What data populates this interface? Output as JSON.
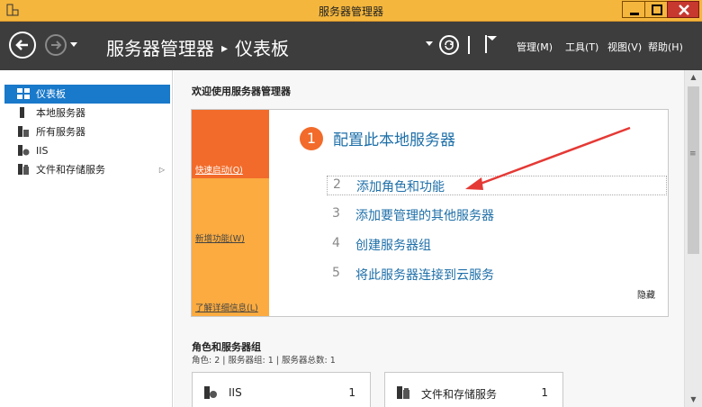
{
  "window": {
    "title": "服务器管理器"
  },
  "nav": {
    "breadcrumb_root": "服务器管理器",
    "breadcrumb_sep": "▸",
    "breadcrumb_current": "仪表板",
    "menus": [
      "管理(M)",
      "工具(T)",
      "视图(V)",
      "帮助(H)"
    ]
  },
  "sidebar": {
    "items": [
      {
        "label": "仪表板",
        "icon": "dashboard-icon",
        "active": true
      },
      {
        "label": "本地服务器",
        "icon": "server-icon"
      },
      {
        "label": "所有服务器",
        "icon": "servers-icon"
      },
      {
        "label": "IIS",
        "icon": "iis-icon"
      },
      {
        "label": "文件和存储服务",
        "icon": "file-storage-icon",
        "expand": "▷"
      }
    ]
  },
  "main": {
    "welcome": "欢迎使用服务器管理器",
    "tiles": [
      "快速启动(Q)",
      "新增功能(W)",
      "了解详细信息(L)"
    ],
    "step1": {
      "num": "1",
      "label": "配置此本地服务器"
    },
    "steps": [
      {
        "num": "2",
        "label": "添加角色和功能"
      },
      {
        "num": "3",
        "label": "添加要管理的其他服务器"
      },
      {
        "num": "4",
        "label": "创建服务器组"
      },
      {
        "num": "5",
        "label": "将此服务器连接到云服务"
      }
    ],
    "hide": "隐藏",
    "roles_title": "角色和服务器组",
    "roles_sub": "角色: 2 | 服务器组: 1 | 服务器总数: 1",
    "cards": [
      {
        "name": "IIS",
        "count": "1",
        "icon": "iis-icon"
      },
      {
        "name": "文件和存储服务",
        "count": "1",
        "icon": "file-storage-icon"
      }
    ]
  },
  "colors": {
    "accent": "#1979ca",
    "titlebar": "#f4b63d",
    "quickstart": "#f26b2a",
    "tile": "#fbab40",
    "annotation_arrow": "#e53935"
  }
}
